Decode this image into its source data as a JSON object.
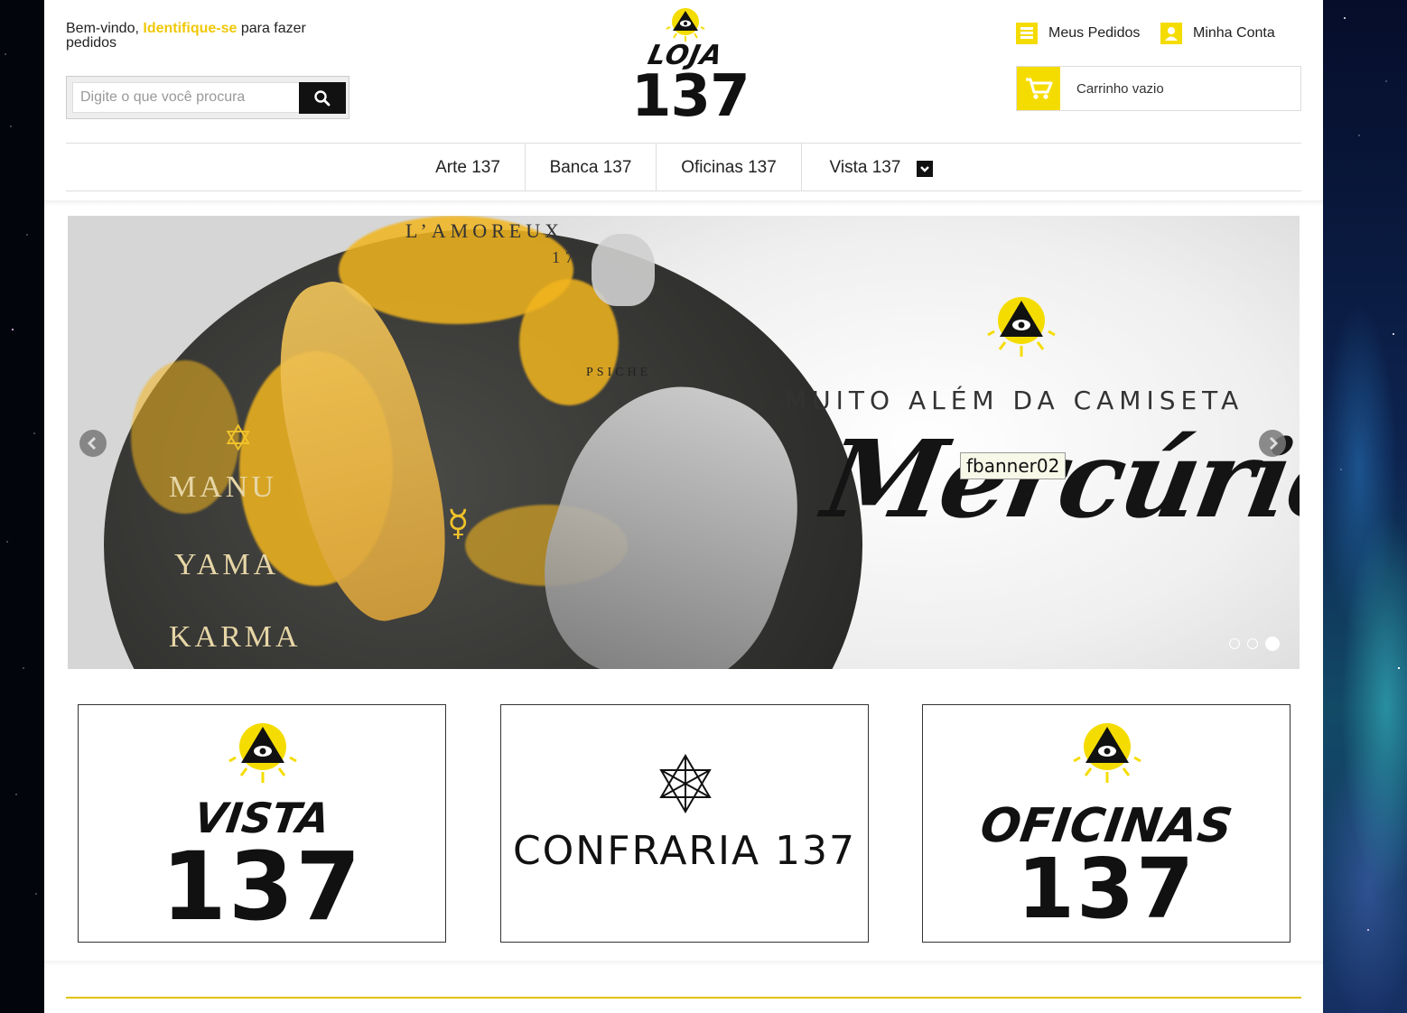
{
  "header": {
    "welcome_prefix": "Bem-vindo, ",
    "login_link": "Identifique-se",
    "welcome_suffix": " para fazer pedidos",
    "search_placeholder": "Digite o que você procura",
    "search_value": ""
  },
  "logo": {
    "word": "LOJA",
    "number": "137"
  },
  "account": {
    "orders_label": "Meus Pedidos",
    "account_label": "Minha Conta",
    "cart_label": "Carrinho vazio"
  },
  "nav": {
    "items": [
      {
        "label": "Arte 137"
      },
      {
        "label": "Banca 137"
      },
      {
        "label": "Oficinas 137"
      },
      {
        "label": "Vista 137"
      }
    ]
  },
  "banner": {
    "art_title": "L’AMOREUX",
    "art_number": "17",
    "art_caption": "PSICHE",
    "left_words": [
      "MANU",
      "YAMA",
      "KARMA"
    ],
    "tagline": "MUITO ALÉM DA CAMISETA",
    "title": "Mercúrio",
    "tooltip": "fbanner02",
    "slides": 3,
    "active_slide": 3
  },
  "tiles": [
    {
      "line1": "VISTA",
      "line2": "137",
      "emblem": "eye-triangle-icon"
    },
    {
      "line1": "CONFRARIA 137",
      "emblem": "merkaba-icon"
    },
    {
      "line1": "OFICINAS",
      "line2": "137",
      "emblem": "eye-triangle-icon"
    }
  ],
  "colors": {
    "accent": "#f5dc00",
    "link": "#f0c808",
    "dark": "#111111"
  }
}
